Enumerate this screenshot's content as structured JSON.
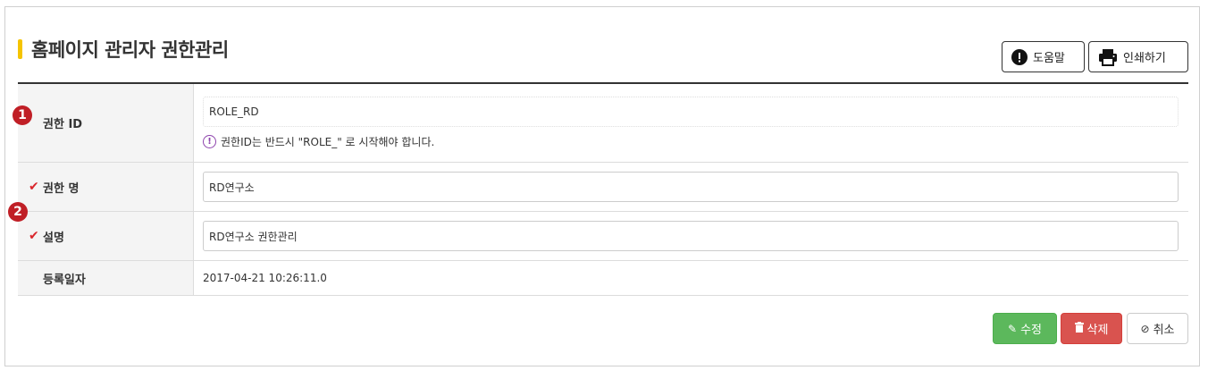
{
  "page": {
    "title": "홈페이지 관리자 권한관리"
  },
  "toolbar": {
    "help_label": "도움말",
    "print_label": "인쇄하기"
  },
  "badges": [
    "1",
    "2"
  ],
  "form": {
    "role_id": {
      "label": "권한 ID",
      "value": "ROLE_RD",
      "hint": "권한ID는 반드시 \"ROLE_\" 로 시작해야 합니다.",
      "hint_icon": "exclamation-circle-icon"
    },
    "role_name": {
      "label": "권한 명",
      "value": "RD연구소",
      "required_icon": "check-icon"
    },
    "description": {
      "label": "설명",
      "value": "RD연구소 권한관리",
      "required_icon": "check-icon"
    },
    "reg_date": {
      "label": "등록일자",
      "value": "2017-04-21 10:26:11.0"
    }
  },
  "actions": {
    "edit_label": "수정",
    "delete_label": "삭제",
    "cancel_label": "취소"
  },
  "colors": {
    "accent": "#f5c400",
    "edit": "#5cb85c",
    "delete": "#d9534f",
    "badge": "#c01f26",
    "required": "#d9262c"
  }
}
